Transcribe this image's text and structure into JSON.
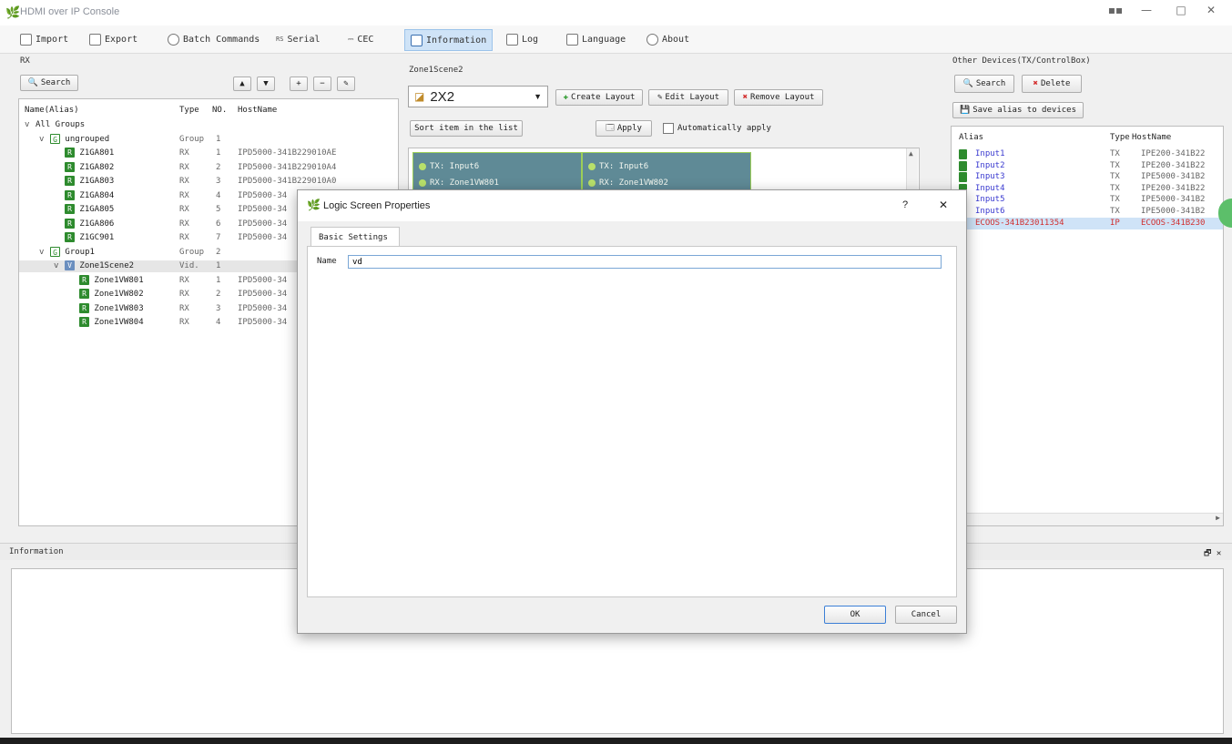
{
  "window": {
    "title": "HDMI over IP Console",
    "controls": {
      "minimize": "—",
      "maximize": "□",
      "close": "✕",
      "extra": "▪▪"
    }
  },
  "toolbar": {
    "import": "Import",
    "export": "Export",
    "batch": "Batch Commands",
    "serial": "Serial",
    "serial_prefix": "RS",
    "cec": "CEC",
    "information": "Information",
    "log": "Log",
    "language": "Language",
    "about": "About"
  },
  "left": {
    "label": "RX",
    "search": "Search",
    "columns": {
      "name": "Name(Alias)",
      "type": "Type",
      "no": "NO.",
      "host": "HostName"
    },
    "tree": [
      {
        "indent": 0,
        "arrow": "v",
        "name": "All Groups",
        "type": "",
        "no": "",
        "host": "",
        "icon": ""
      },
      {
        "indent": 1,
        "arrow": "v",
        "name": "ungrouped",
        "type": "Group",
        "no": "1",
        "host": "",
        "icon": "G"
      },
      {
        "indent": 2,
        "arrow": "",
        "name": "Z1GA801",
        "type": "RX",
        "no": "1",
        "host": "IPD5000-341B229010AE",
        "icon": "R"
      },
      {
        "indent": 2,
        "arrow": "",
        "name": "Z1GA802",
        "type": "RX",
        "no": "2",
        "host": "IPD5000-341B229010A4",
        "icon": "R"
      },
      {
        "indent": 2,
        "arrow": "",
        "name": "Z1GA803",
        "type": "RX",
        "no": "3",
        "host": "IPD5000-341B229010A0",
        "icon": "R"
      },
      {
        "indent": 2,
        "arrow": "",
        "name": "Z1GA804",
        "type": "RX",
        "no": "4",
        "host": "IPD5000-34",
        "icon": "R"
      },
      {
        "indent": 2,
        "arrow": "",
        "name": "Z1GA805",
        "type": "RX",
        "no": "5",
        "host": "IPD5000-34",
        "icon": "R"
      },
      {
        "indent": 2,
        "arrow": "",
        "name": "Z1GA806",
        "type": "RX",
        "no": "6",
        "host": "IPD5000-34",
        "icon": "R"
      },
      {
        "indent": 2,
        "arrow": "",
        "name": "Z1GC901",
        "type": "RX",
        "no": "7",
        "host": "IPD5000-34",
        "icon": "R"
      },
      {
        "indent": 1,
        "arrow": "v",
        "name": "Group1",
        "type": "Group",
        "no": "2",
        "host": "",
        "icon": "G"
      },
      {
        "indent": 2,
        "arrow": "v",
        "name": "Zone1Scene2",
        "type": "Vid.",
        "no": "1",
        "host": "",
        "icon": "V",
        "selected": true
      },
      {
        "indent": 3,
        "arrow": "",
        "name": "Zone1VW801",
        "type": "RX",
        "no": "1",
        "host": "IPD5000-34",
        "icon": "R"
      },
      {
        "indent": 3,
        "arrow": "",
        "name": "Zone1VW802",
        "type": "RX",
        "no": "2",
        "host": "IPD5000-34",
        "icon": "R"
      },
      {
        "indent": 3,
        "arrow": "",
        "name": "Zone1VW803",
        "type": "RX",
        "no": "3",
        "host": "IPD5000-34",
        "icon": "R"
      },
      {
        "indent": 3,
        "arrow": "",
        "name": "Zone1VW804",
        "type": "RX",
        "no": "4",
        "host": "IPD5000-34",
        "icon": "R"
      }
    ]
  },
  "center": {
    "group_title": "Zone1Scene2",
    "layout_value": "2X2",
    "create": "Create Layout",
    "edit": "Edit Layout",
    "remove": "Remove Layout",
    "sort": "Sort item in the list",
    "apply": "Apply",
    "auto_apply": "Automatically apply",
    "tiles": [
      {
        "tx": "TX: Input6",
        "rx": "RX: Zone1VW801"
      },
      {
        "tx": "TX: Input6",
        "rx": "RX: Zone1VW802"
      }
    ]
  },
  "right": {
    "title": "Other Devices(TX/ControlBox)",
    "search": "Search",
    "delete": "Delete",
    "save": "Save alias to devices",
    "columns": {
      "alias": "Alias",
      "type": "Type",
      "host": "HostName"
    },
    "rows": [
      {
        "alias": "Input1",
        "type": "TX",
        "host": "IPE200-341B22"
      },
      {
        "alias": "Input2",
        "type": "TX",
        "host": "IPE200-341B22"
      },
      {
        "alias": "Input3",
        "type": "TX",
        "host": "IPE5000-341B2"
      },
      {
        "alias": "Input4",
        "type": "TX",
        "host": "IPE200-341B22"
      },
      {
        "alias": "Input5",
        "type": "TX",
        "host": "IPE5000-341B2"
      },
      {
        "alias": "Input6",
        "type": "TX",
        "host": "IPE5000-341B2"
      },
      {
        "alias": "ECOOS-341B23011354",
        "type": "IP",
        "host": "ECOOS-341B230",
        "selected": true
      }
    ]
  },
  "info": {
    "title": "Information",
    "controls": "🗗 ✕"
  },
  "dialog": {
    "title": "Logic Screen Properties",
    "help": "?",
    "close": "✕",
    "tab": "Basic Settings",
    "name_label": "Name",
    "name_value": "vd",
    "ok": "OK",
    "cancel": "Cancel"
  },
  "colors": {
    "accent": "#cfe3f7",
    "tile": "#5f8a96",
    "tile_border": "#9ccf57",
    "device_green": "#2e8b2e",
    "alias_blue": "#3a3ad0",
    "selected_red": "#d03030"
  }
}
